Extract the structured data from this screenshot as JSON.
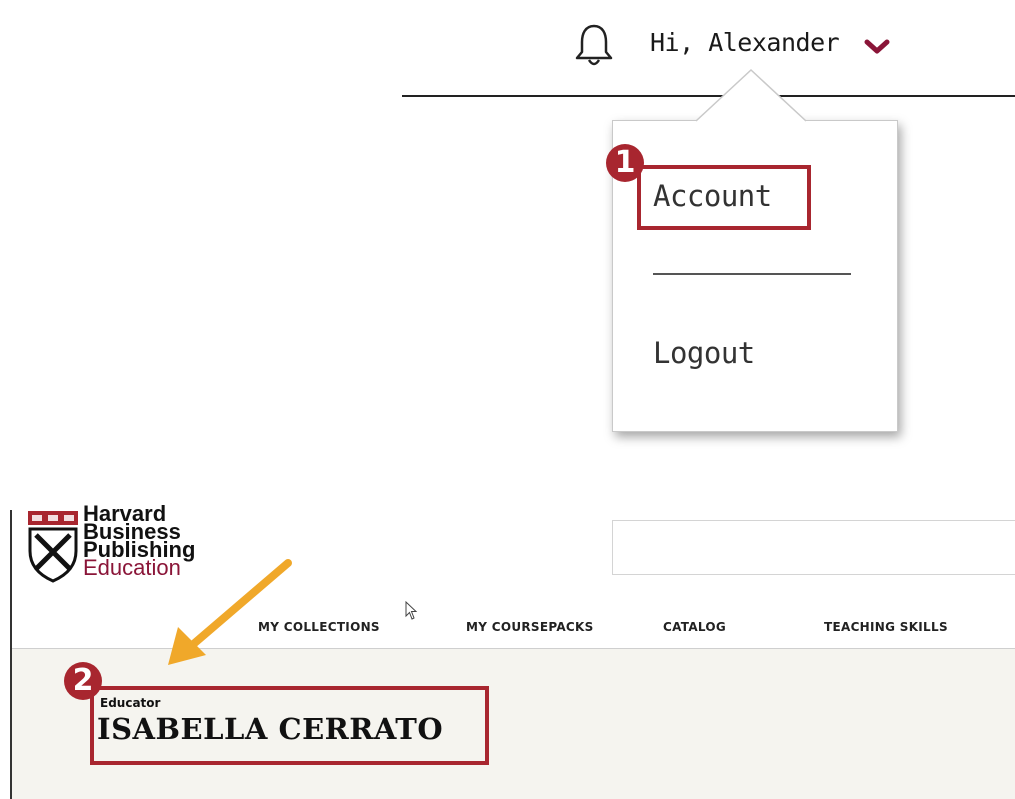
{
  "header": {
    "greeting": "Hi, Alexander",
    "icons": {
      "notification": "bell-icon",
      "dropdown": "chevron-down-icon"
    },
    "accent_color": "#8a1538"
  },
  "user_menu": {
    "items": [
      {
        "label": "Account"
      },
      {
        "label": "Logout"
      }
    ]
  },
  "annotations": {
    "step1": "1",
    "step2": "2",
    "highlight_color": "#a8262f",
    "arrow_color": "#f0a82a"
  },
  "site": {
    "logo_lines": [
      "Harvard",
      "Business",
      "Publishing",
      "Education"
    ],
    "nav": [
      "MY COLLECTIONS",
      "MY COURSEPACKS",
      "CATALOG",
      "TEACHING SKILLS"
    ]
  },
  "profile": {
    "role": "Educator",
    "name": "ISABELLA CERRATO"
  }
}
